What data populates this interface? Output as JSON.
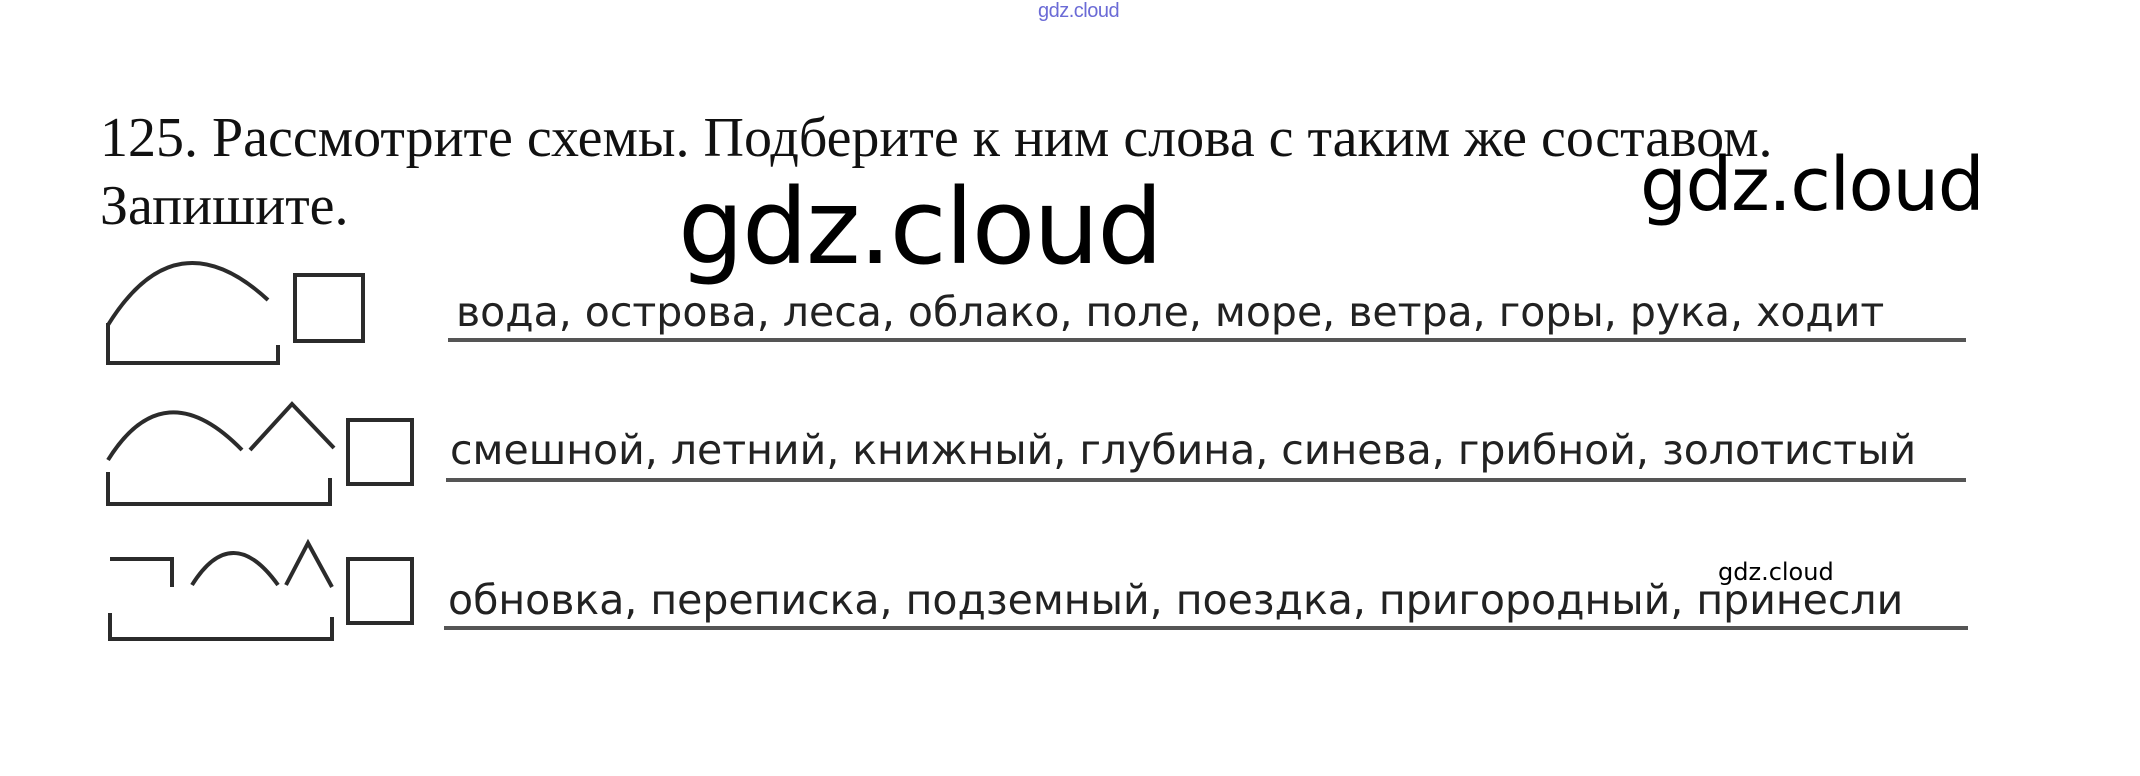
{
  "watermarks": {
    "top": "gdz.cloud",
    "large": "gdz.cloud",
    "medium": "gdz.cloud",
    "small": "gdz.cloud"
  },
  "task": {
    "line1": "125. Рассмотрите схемы. Подберите к ним слова с таким же составом.",
    "line2": "Запишите."
  },
  "rows": [
    {
      "scheme_icon": "root-ending-scheme",
      "words": "вода, острова, леса, облако, поле, море, ветра, горы, рука, ходит"
    },
    {
      "scheme_icon": "root-suffix-ending-scheme",
      "words": "смешной, летний, книжный, глубина, синева, грибной, золотистый"
    },
    {
      "scheme_icon": "prefix-root-suffix-ending-scheme",
      "words": "обновка, переписка, подземный, поездка, пригородный, принесли"
    }
  ]
}
